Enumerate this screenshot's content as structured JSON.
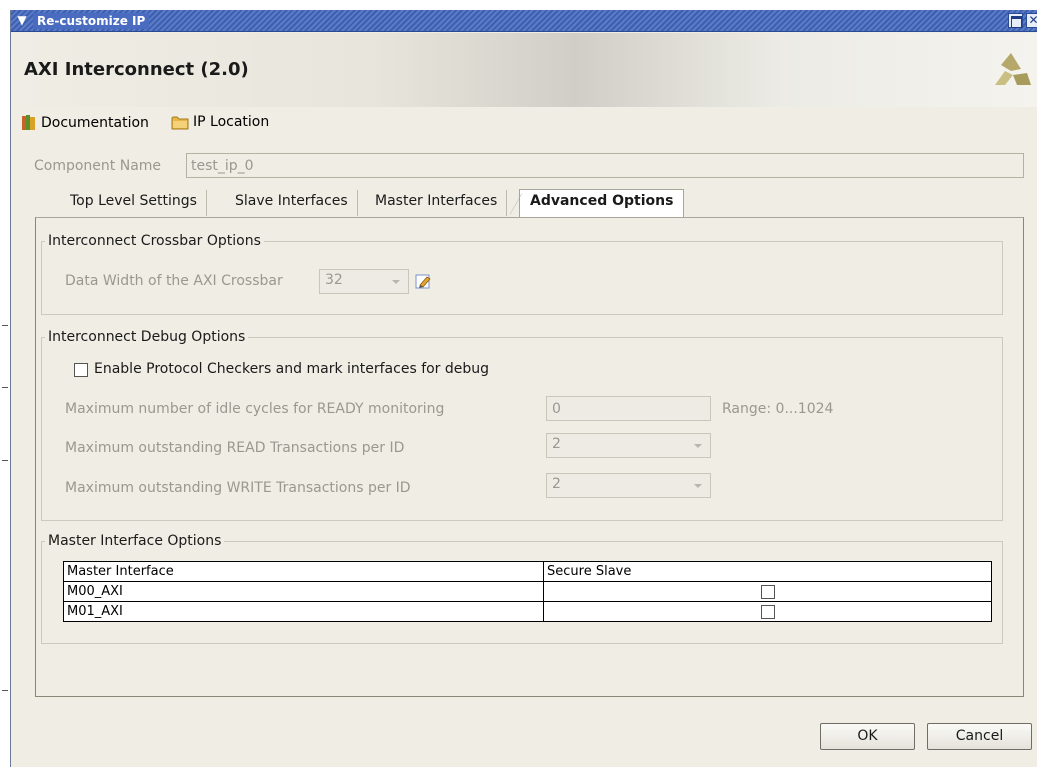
{
  "window": {
    "title": "Re-customize IP"
  },
  "header": {
    "heading": "AXI Interconnect (2.0)"
  },
  "toolbar": {
    "documentation": "Documentation",
    "ip_location": "IP Location"
  },
  "component": {
    "label": "Component Name",
    "value": "test_ip_0"
  },
  "tabs": [
    {
      "label": "Top Level Settings",
      "active": false
    },
    {
      "label": "Slave Interfaces",
      "active": false
    },
    {
      "label": "Master Interfaces",
      "active": false
    },
    {
      "label": "Advanced Options",
      "active": true
    }
  ],
  "crossbar": {
    "legend": "Interconnect Crossbar Options",
    "data_width_label": "Data Width of the AXI Crossbar",
    "data_width_value": "32"
  },
  "debug": {
    "legend": "Interconnect Debug Options",
    "protocol_checker_label": "Enable Protocol Checkers and mark interfaces for debug",
    "protocol_checker_checked": false,
    "idle_cycles_label": "Maximum number of idle cycles for READY monitoring",
    "idle_cycles_value": "0",
    "idle_cycles_range": "Range: 0...1024",
    "read_txn_label": "Maximum outstanding READ Transactions per ID",
    "read_txn_value": "2",
    "write_txn_label": "Maximum outstanding WRITE Transactions per ID",
    "write_txn_value": "2"
  },
  "master_options": {
    "legend": "Master Interface Options",
    "columns": [
      "Master Interface",
      "Secure Slave"
    ],
    "rows": [
      {
        "name": "M00_AXI",
        "secure": false
      },
      {
        "name": "M01_AXI",
        "secure": false
      }
    ]
  },
  "buttons": {
    "ok": "OK",
    "cancel": "Cancel"
  }
}
